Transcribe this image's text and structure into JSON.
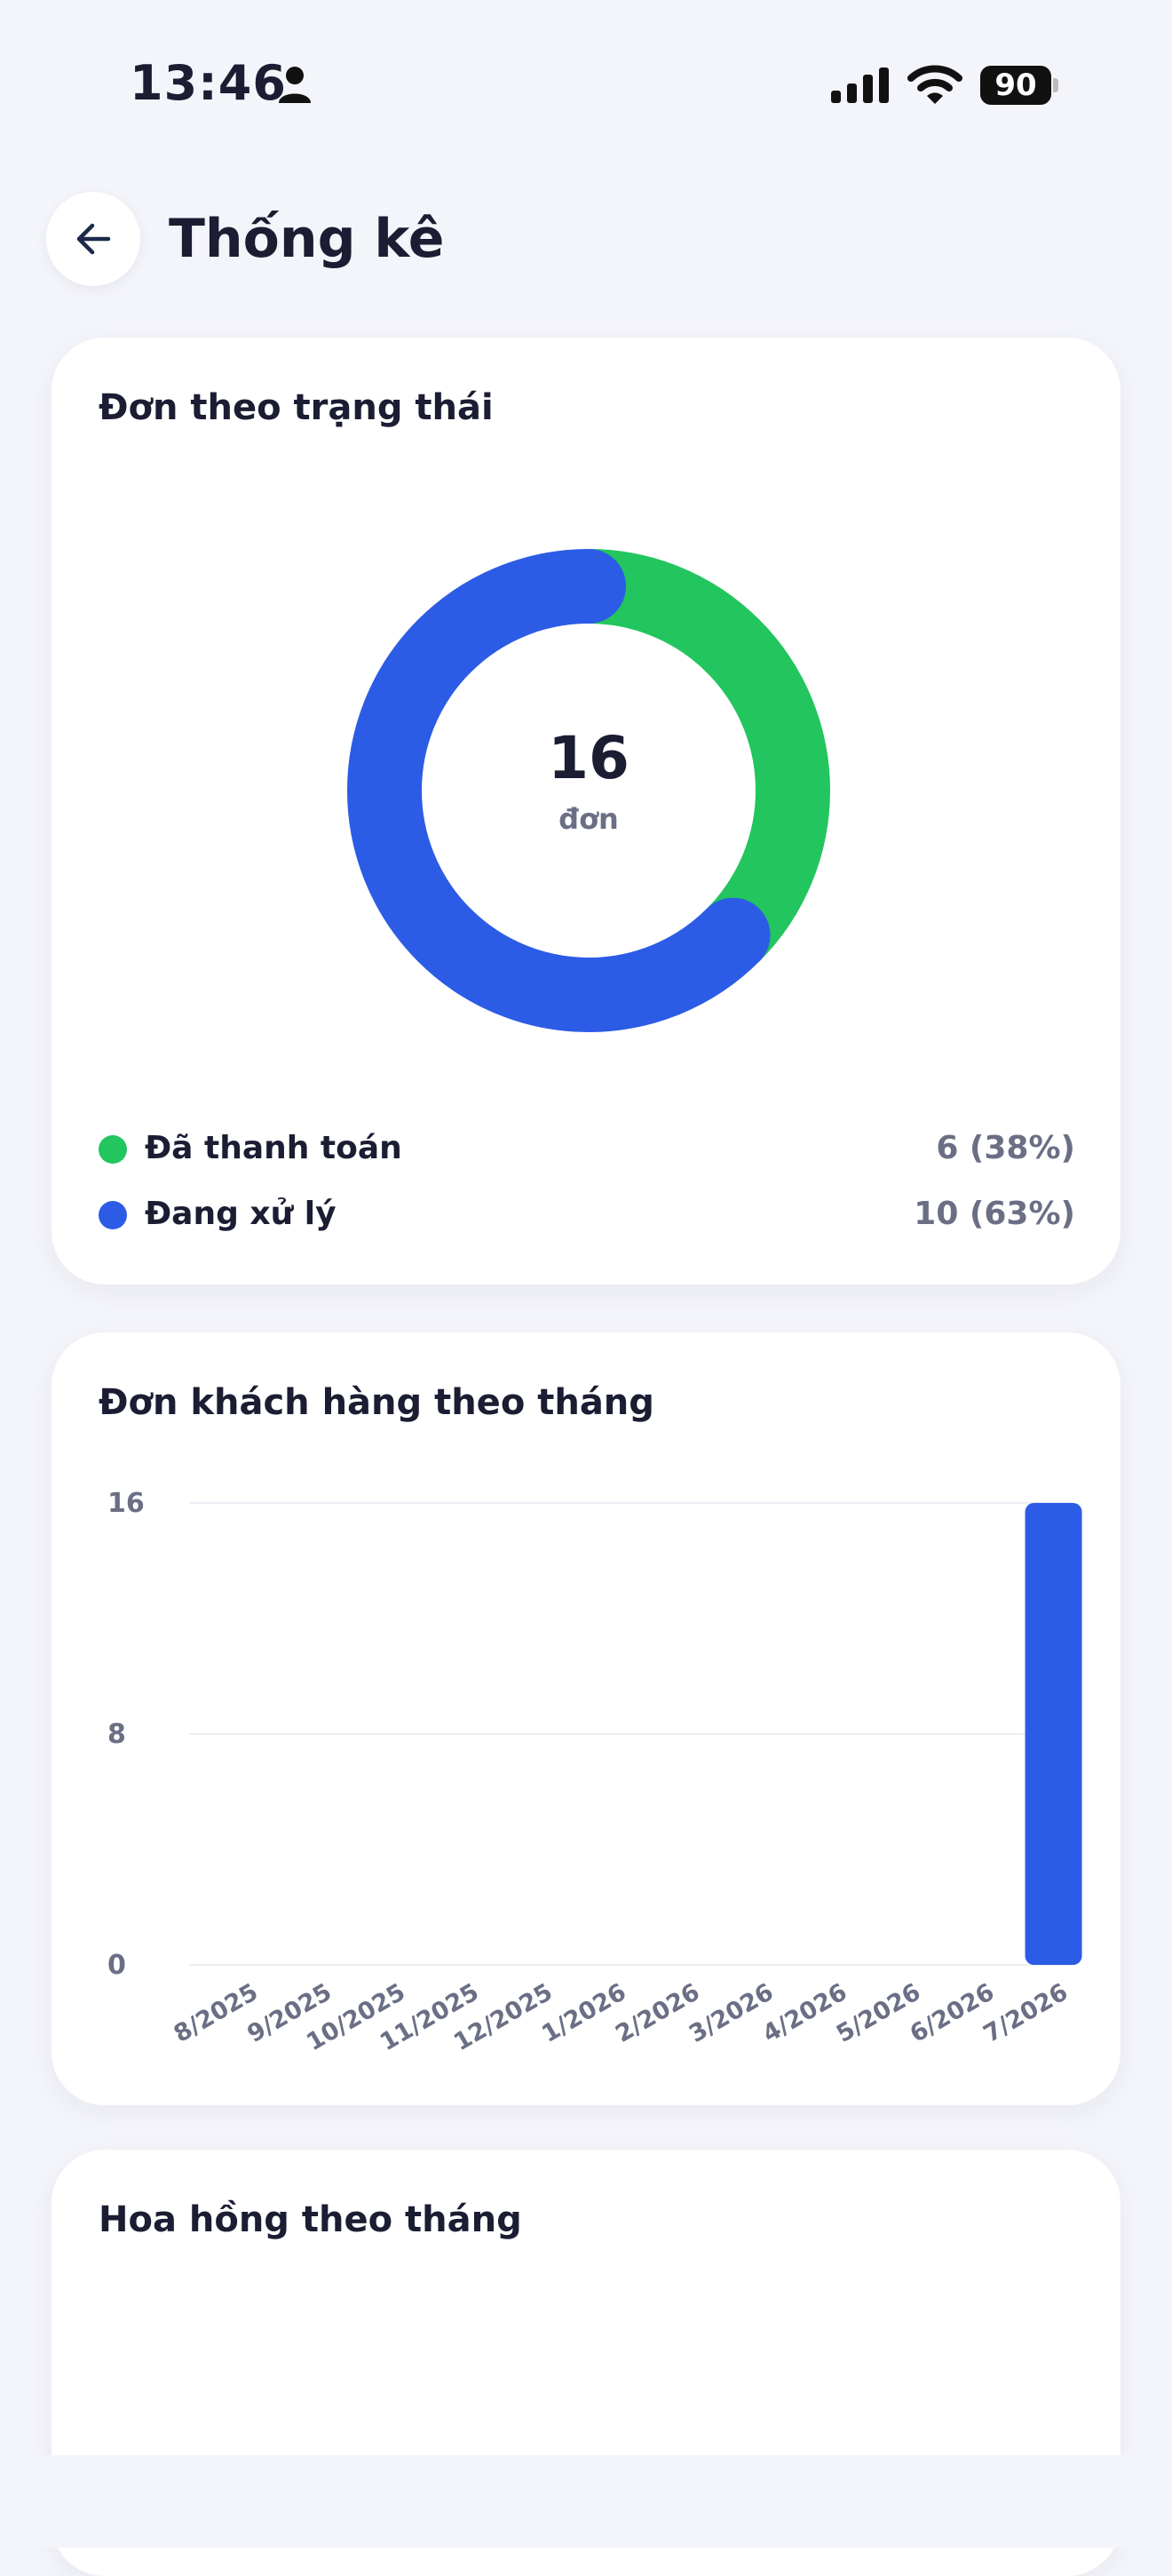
{
  "status_bar": {
    "time": "13:46",
    "battery": "90"
  },
  "header": {
    "title": "Thống kê"
  },
  "status_card": {
    "title": "Đơn theo trạng thái",
    "total": "16",
    "total_unit": "đơn",
    "legend": [
      {
        "label": "Đã thanh toán",
        "value": "6 (38%)",
        "color": "#22c55e",
        "count": 6
      },
      {
        "label": "Đang xử lý",
        "value": "10 (63%)",
        "color": "#2c5ce6",
        "count": 10
      }
    ]
  },
  "monthly_orders_card": {
    "title": "Đơn khách hàng theo tháng"
  },
  "commission_card": {
    "title": "Hoa hồng theo tháng"
  },
  "chart_data": [
    {
      "type": "pie",
      "title": "Đơn theo trạng thái",
      "categories": [
        "Đã thanh toán",
        "Đang xử lý"
      ],
      "values": [
        6,
        10
      ],
      "colors": [
        "#22c55e",
        "#2c5ce6"
      ]
    },
    {
      "type": "bar",
      "title": "Đơn khách hàng theo tháng",
      "categories": [
        "8/2025",
        "9/2025",
        "10/2025",
        "11/2025",
        "12/2025",
        "1/2026",
        "2/2026",
        "3/2026",
        "4/2026",
        "5/2026",
        "6/2026",
        "7/2026"
      ],
      "values": [
        0,
        0,
        0,
        0,
        0,
        0,
        0,
        0,
        0,
        0,
        0,
        16
      ],
      "yticks": [
        "0",
        "8",
        "16"
      ],
      "ylim": [
        0,
        16
      ],
      "color": "#2c5ce6",
      "grid": true
    }
  ]
}
